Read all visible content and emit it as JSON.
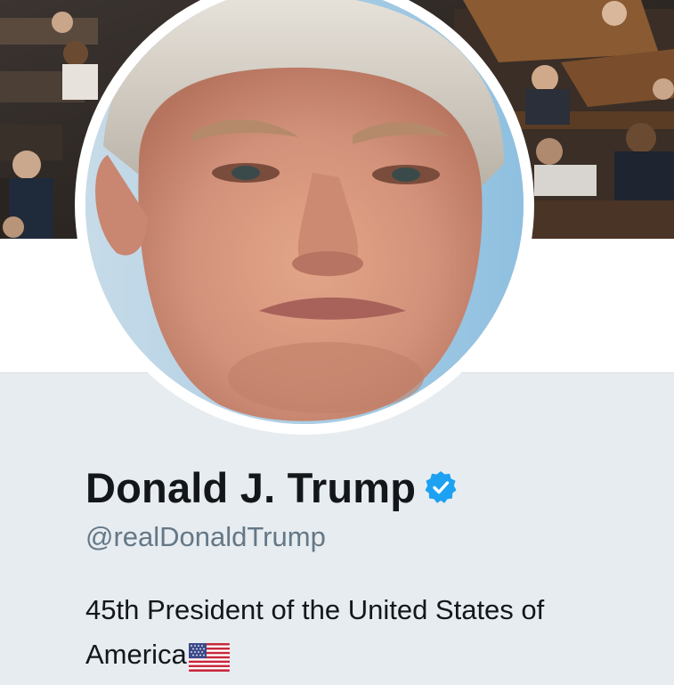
{
  "profile": {
    "display_name": "Donald J. Trump",
    "handle": "@realDonaldTrump",
    "verified": true,
    "bio_line1": "45th President of the United States of",
    "bio_line2": "America",
    "bio_emoji": "us-flag-emoji"
  },
  "images": {
    "banner": "banner-photo",
    "avatar": "profile-photo"
  },
  "colors": {
    "verified_blue": "#1da1f2",
    "name_text": "#14171a",
    "handle_text": "#657786",
    "panel_background": "#e6ecf0"
  }
}
